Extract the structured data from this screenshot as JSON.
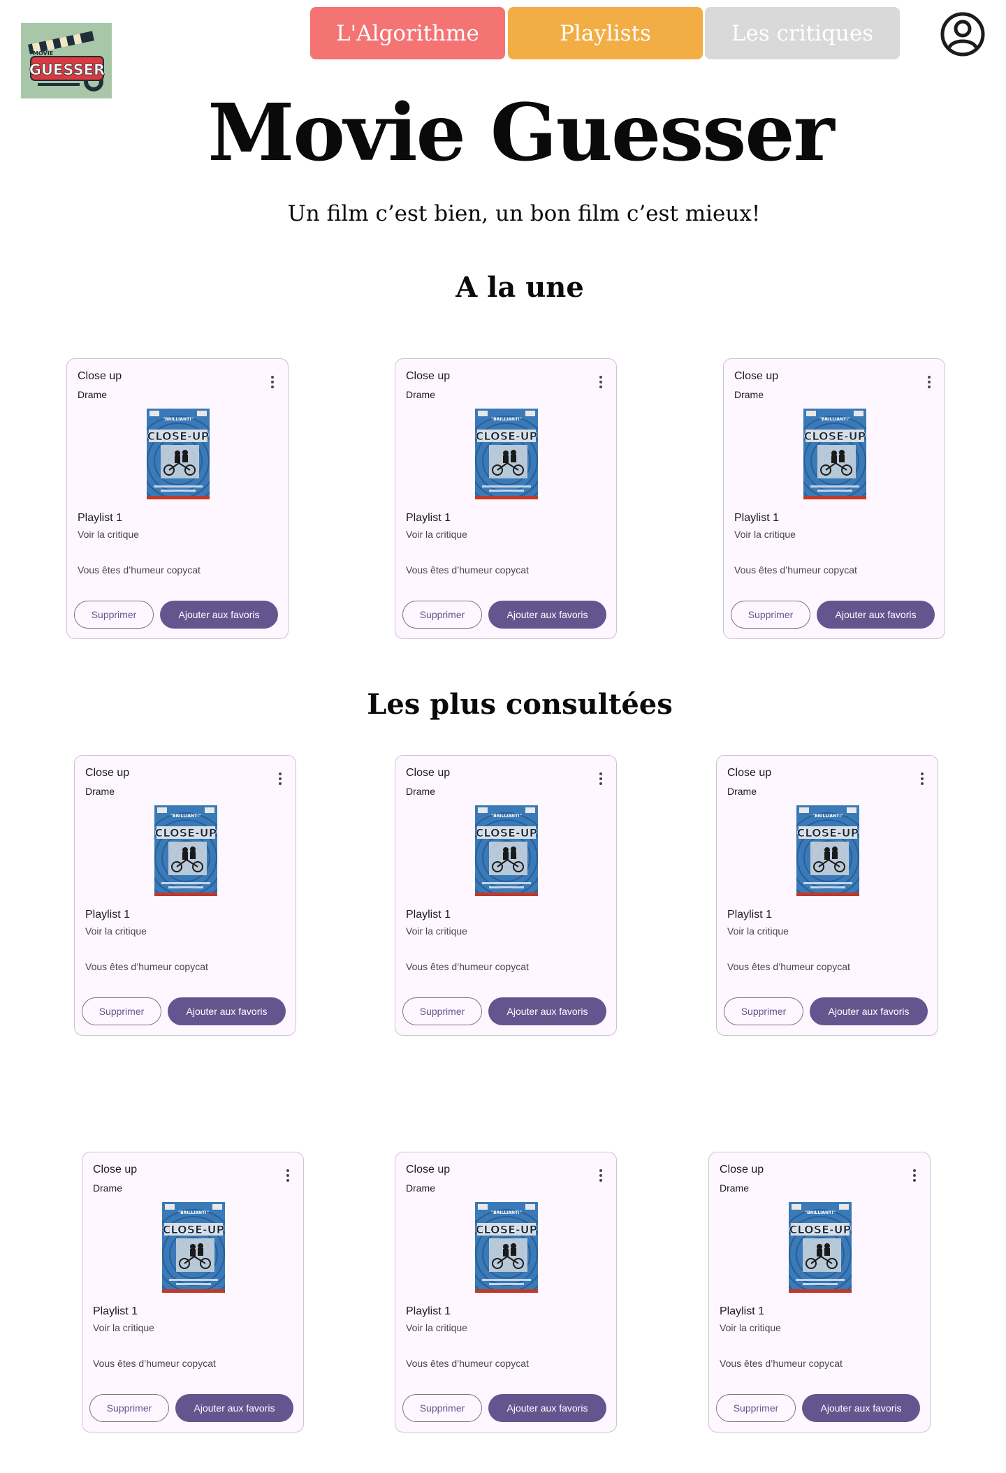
{
  "logo": {
    "top_text": "MOVIE",
    "main_text": "GUESSER",
    "colors": {
      "background": "#a8c7a8",
      "accent": "#d93a3f"
    }
  },
  "nav": {
    "items": [
      {
        "label": "L'Algorithme",
        "color": "#f47373"
      },
      {
        "label": "Playlists",
        "color": "#f2ad44"
      },
      {
        "label": "Les critiques",
        "color": "#d9d9d9"
      }
    ],
    "account_icon": "account-circle-icon"
  },
  "hero": {
    "title": "Movie Guesser",
    "subtitle": "Un film c’est bien, un bon film c’est mieux!"
  },
  "sections": [
    {
      "title": "A la une",
      "cards": [
        {
          "title": "Close up",
          "genre": "Drame",
          "playlist": "Playlist 1",
          "link": "Voir la critique",
          "mood": "Vous êtes d’humeur copycat",
          "poster": {
            "headline": "\"BRILLIANT!\"",
            "title": "CLOSE-UP"
          },
          "actions": {
            "delete": "Supprimer",
            "favorite": "Ajouter aux favoris"
          }
        },
        {
          "title": "Close up",
          "genre": "Drame",
          "playlist": "Playlist 1",
          "link": "Voir la critique",
          "mood": "Vous êtes d’humeur copycat",
          "poster": {
            "headline": "\"BRILLIANT!\"",
            "title": "CLOSE-UP"
          },
          "actions": {
            "delete": "Supprimer",
            "favorite": "Ajouter aux favoris"
          }
        },
        {
          "title": "Close up",
          "genre": "Drame",
          "playlist": "Playlist 1",
          "link": "Voir la critique",
          "mood": "Vous êtes d’humeur copycat",
          "poster": {
            "headline": "\"BRILLIANT!\"",
            "title": "CLOSE-UP"
          },
          "actions": {
            "delete": "Supprimer",
            "favorite": "Ajouter aux favoris"
          }
        }
      ]
    },
    {
      "title": "Les plus consultées",
      "cards": [
        {
          "title": "Close up",
          "genre": "Drame",
          "playlist": "Playlist 1",
          "link": "Voir la critique",
          "mood": "Vous êtes d’humeur copycat",
          "poster": {
            "headline": "\"BRILLIANT!\"",
            "title": "CLOSE-UP"
          },
          "actions": {
            "delete": "Supprimer",
            "favorite": "Ajouter aux favoris"
          }
        },
        {
          "title": "Close up",
          "genre": "Drame",
          "playlist": "Playlist 1",
          "link": "Voir la critique",
          "mood": "Vous êtes d’humeur copycat",
          "poster": {
            "headline": "\"BRILLIANT!\"",
            "title": "CLOSE-UP"
          },
          "actions": {
            "delete": "Supprimer",
            "favorite": "Ajouter aux favoris"
          }
        },
        {
          "title": "Close up",
          "genre": "Drame",
          "playlist": "Playlist 1",
          "link": "Voir la critique",
          "mood": "Vous êtes d’humeur copycat",
          "poster": {
            "headline": "\"BRILLIANT!\"",
            "title": "CLOSE-UP"
          },
          "actions": {
            "delete": "Supprimer",
            "favorite": "Ajouter aux favoris"
          }
        },
        {
          "title": "Close up",
          "genre": "Drame",
          "playlist": "Playlist 1",
          "link": "Voir la critique",
          "mood": "Vous êtes d’humeur copycat",
          "poster": {
            "headline": "\"BRILLIANT!\"",
            "title": "CLOSE-UP"
          },
          "actions": {
            "delete": "Supprimer",
            "favorite": "Ajouter aux favoris"
          }
        },
        {
          "title": "Close up",
          "genre": "Drame",
          "playlist": "Playlist 1",
          "link": "Voir la critique",
          "mood": "Vous êtes d’humeur copycat",
          "poster": {
            "headline": "\"BRILLIANT!\"",
            "title": "CLOSE-UP"
          },
          "actions": {
            "delete": "Supprimer",
            "favorite": "Ajouter aux favoris"
          }
        },
        {
          "title": "Close up",
          "genre": "Drame",
          "playlist": "Playlist 1",
          "link": "Voir la critique",
          "mood": "Vous êtes d’humeur copycat",
          "poster": {
            "headline": "\"BRILLIANT!\"",
            "title": "CLOSE-UP"
          },
          "actions": {
            "delete": "Supprimer",
            "favorite": "Ajouter aux favoris"
          }
        }
      ]
    }
  ],
  "theme": {
    "card_bg": "#fef7ff",
    "card_border": "#cac4d0",
    "primary": "#65558f",
    "poster_blue": "#3a7ab8"
  }
}
